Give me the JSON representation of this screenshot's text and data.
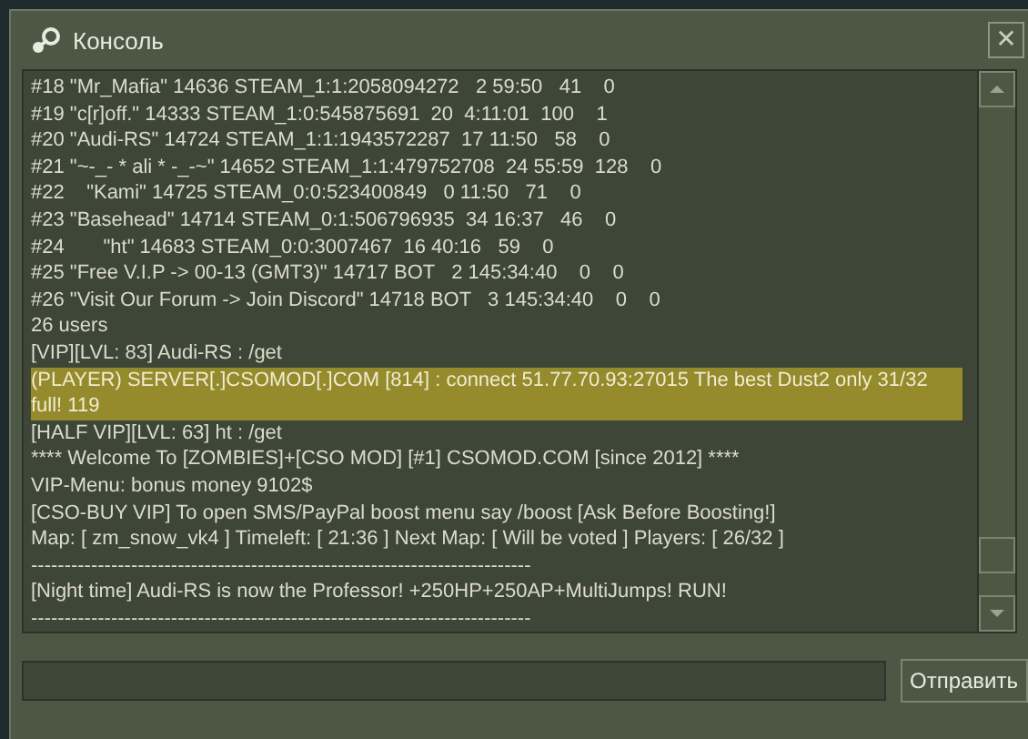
{
  "window": {
    "title": "Консоль",
    "close": "✕"
  },
  "console": {
    "lines": [
      {
        "text": "#18 \"Mr_Mafia\" 14636 STEAM_1:1:2058094272   2 59:50   41    0",
        "highlighted": false
      },
      {
        "text": "#19 \"c[r]off.\" 14333 STEAM_1:0:545875691  20  4:11:01  100    1",
        "highlighted": false
      },
      {
        "text": "#20 \"Audi-RS\" 14724 STEAM_1:1:1943572287  17 11:50   58    0",
        "highlighted": false
      },
      {
        "text": "#21 \"~-_- * ali * -_-~\" 14652 STEAM_1:1:479752708  24 55:59  128    0",
        "highlighted": false
      },
      {
        "text": "#22    \"Kami\" 14725 STEAM_0:0:523400849   0 11:50   71    0",
        "highlighted": false
      },
      {
        "text": "#23 \"Basehead\" 14714 STEAM_0:1:506796935  34 16:37   46    0",
        "highlighted": false
      },
      {
        "text": "#24       \"ht\" 14683 STEAM_0:0:3007467  16 40:16   59    0",
        "highlighted": false
      },
      {
        "text": "#25 \"Free V.I.P -> 00-13 (GMT3)\" 14717 BOT   2 145:34:40    0    0",
        "highlighted": false
      },
      {
        "text": "#26 \"Visit Our Forum -> Join Discord\" 14718 BOT   3 145:34:40    0    0",
        "highlighted": false
      },
      {
        "text": "26 users",
        "highlighted": false
      },
      {
        "text": "[VIP][LVL: 83] Audi-RS : /get",
        "highlighted": false
      },
      {
        "text": "(PLAYER) SERVER[.]CSOMOD[.]COM [814] : connect 51.77.70.93:27015 The best Dust2 only 31/32 full! 119",
        "highlighted": true
      },
      {
        "text": "[HALF VIP][LVL: 63] ht : /get",
        "highlighted": false
      },
      {
        "text": "**** Welcome To [ZOMBIES]+[CSO MOD] [#1] CSOMOD.COM [since 2012] ****",
        "highlighted": false
      },
      {
        "text": "VIP-Menu: bonus money 9102$",
        "highlighted": false
      },
      {
        "text": "[CSO-BUY VIP] To open SMS/PayPal boost menu say /boost [Ask Before Boosting!]",
        "highlighted": false
      },
      {
        "text": "Map: [ zm_snow_vk4 ] Timeleft: [ 21:36 ] Next Map: [ Will be voted ] Players: [ 26/32 ]",
        "highlighted": false
      },
      {
        "text": "---------------------------------------------------------------------------",
        "highlighted": false
      },
      {
        "text": "[Night time] Audi-RS is now the Professor! +250HP+250AP+MultiJumps! RUN!",
        "highlighted": false
      },
      {
        "text": "---------------------------------------------------------------------------",
        "highlighted": false
      }
    ]
  },
  "send_button": "Отправить"
}
